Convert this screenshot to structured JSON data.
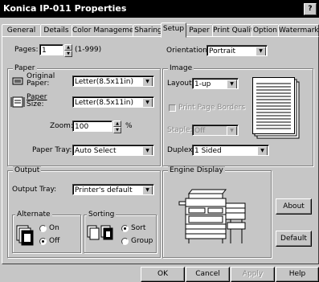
{
  "window": {
    "title": "Konica IP-011 Properties",
    "help_label": "?"
  },
  "tabs": [
    {
      "label": "General"
    },
    {
      "label": "Details"
    },
    {
      "label": "Color Management"
    },
    {
      "label": "Sharing"
    },
    {
      "label": "Setup"
    },
    {
      "label": "Paper"
    },
    {
      "label": "Print Quality"
    },
    {
      "label": "Option"
    },
    {
      "label": "Watermark"
    }
  ],
  "active_tab": "Setup",
  "pages": {
    "label": "Pages:",
    "value": "1",
    "range": "(1-999)"
  },
  "orientation": {
    "label": "Orientation:",
    "value": "Portrait"
  },
  "paper": {
    "legend": "Paper",
    "original_label_1": "Original",
    "original_label_2": "Paper:",
    "original_value": "Letter(8.5x11in)",
    "size_label_1": "Paper",
    "size_label_2": "Size:",
    "size_value": "Letter(8.5x11in)",
    "zoom_label": "Zoom:",
    "zoom_value": "100",
    "zoom_unit": "%",
    "tray_label": "Paper Tray:",
    "tray_value": "Auto Select"
  },
  "image": {
    "legend": "Image",
    "layout_label": "Layout:",
    "layout_value": "1-up",
    "print_borders_label": "Print Page Borders",
    "staple_label": "Staple:",
    "staple_value": "Off",
    "duplex_label": "Duplex:",
    "duplex_value": "1 Sided"
  },
  "output": {
    "legend": "Output",
    "tray_label": "Output Tray:",
    "tray_value": "Printer's default",
    "alternate_legend": "Alternate",
    "alt_on": "On",
    "alt_off": "Off",
    "sorting_legend": "Sorting",
    "sort": "Sort",
    "group": "Group"
  },
  "engine": {
    "legend": "Engine Display"
  },
  "buttons": {
    "about": "About",
    "default": "Default",
    "ok": "OK",
    "cancel": "Cancel",
    "apply": "Apply",
    "help": "Help"
  }
}
